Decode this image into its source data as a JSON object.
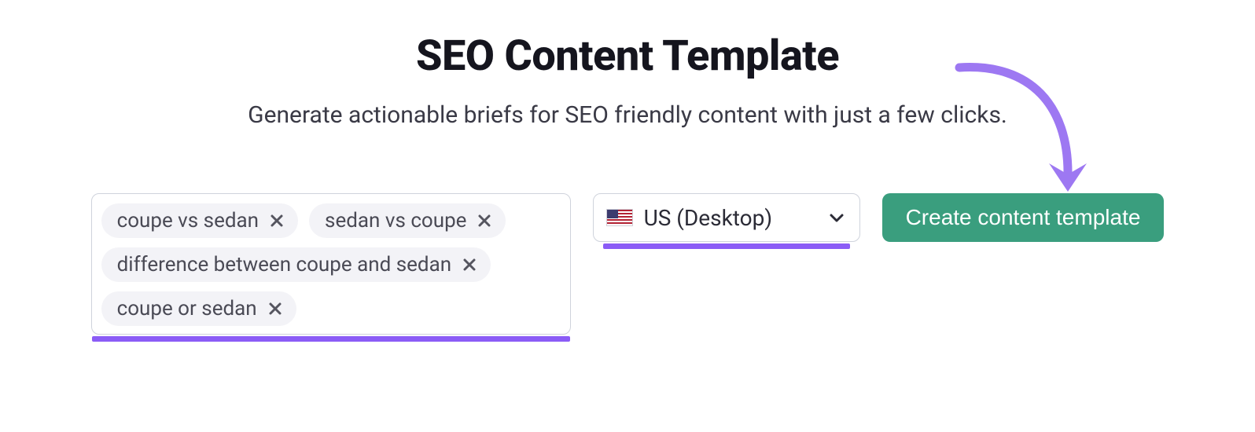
{
  "header": {
    "title": "SEO Content Template",
    "subtitle": "Generate actionable briefs for SEO friendly content with just a few clicks."
  },
  "keywords": {
    "chips": [
      {
        "label": "coupe vs sedan"
      },
      {
        "label": "sedan vs coupe"
      },
      {
        "label": "difference between coupe and sedan"
      },
      {
        "label": "coupe or sedan"
      }
    ]
  },
  "region": {
    "selected_label": "US (Desktop)",
    "flag_icon": "flag-us"
  },
  "cta": {
    "label": "Create content template"
  },
  "accents": {
    "underline_color": "#8b5cf6",
    "button_bg": "#3a9e7e"
  }
}
